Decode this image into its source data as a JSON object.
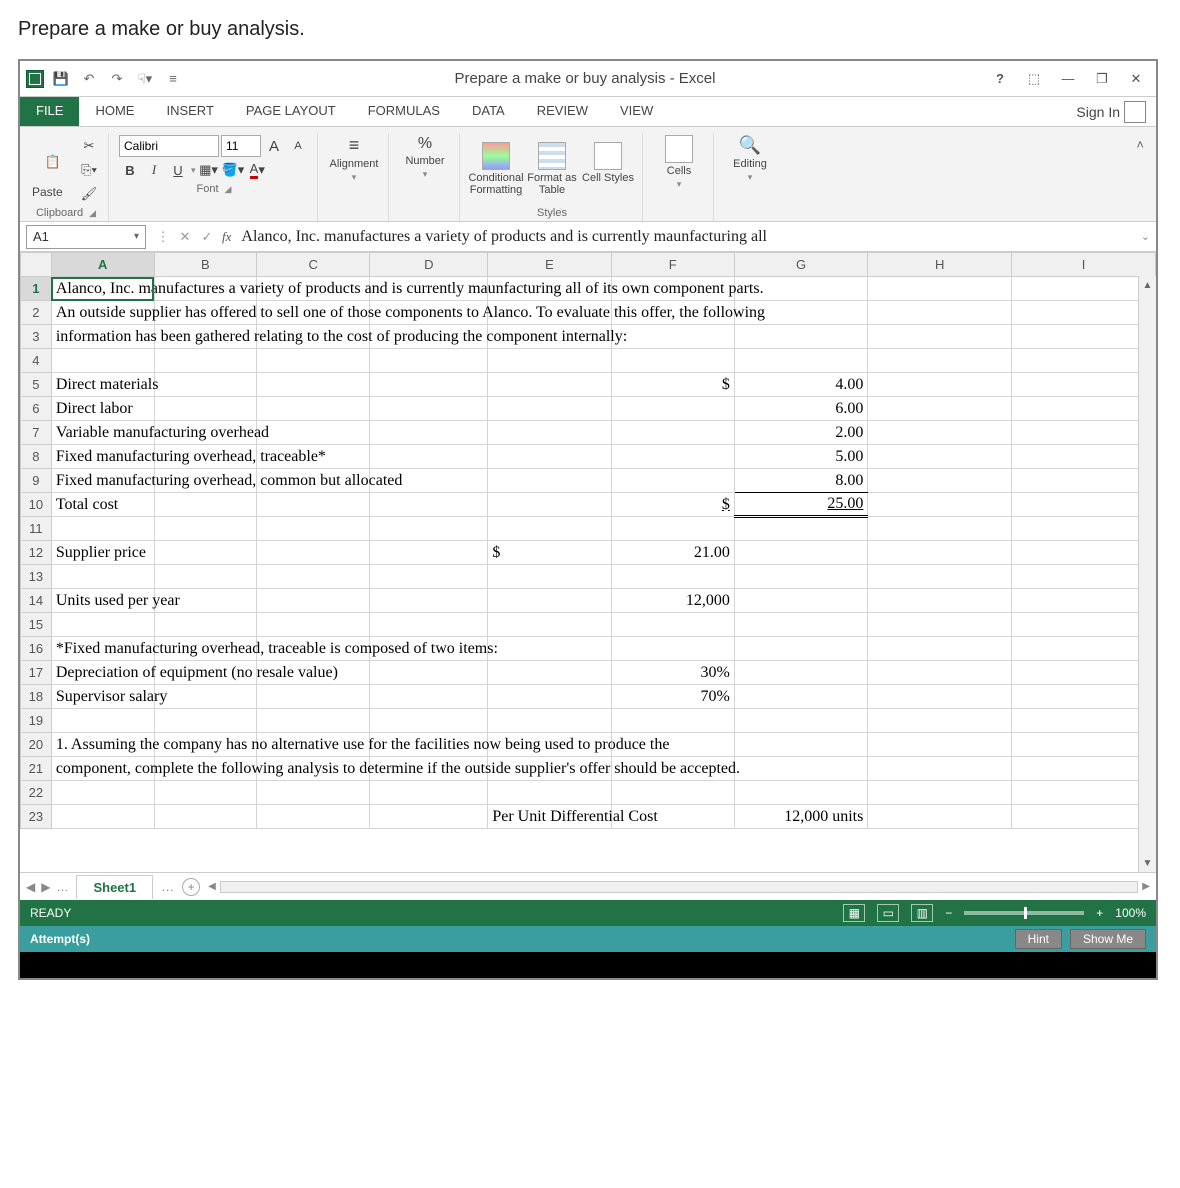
{
  "page_heading": "Prepare a make or buy analysis.",
  "title": "Prepare a make or buy analysis - Excel",
  "menu": {
    "file": "FILE",
    "home": "HOME",
    "insert": "INSERT",
    "page_layout": "PAGE LAYOUT",
    "formulas": "FORMULAS",
    "data": "DATA",
    "review": "REVIEW",
    "view": "VIEW",
    "signin": "Sign In"
  },
  "ribbon": {
    "clipboard": {
      "paste": "Paste",
      "label": "Clipboard"
    },
    "font": {
      "name": "Calibri",
      "size": "11",
      "bold": "B",
      "italic": "I",
      "underline": "U",
      "growA": "A",
      "shrinkA": "A",
      "label": "Font"
    },
    "alignment": {
      "label": "Alignment"
    },
    "number": {
      "percent": "%",
      "label": "Number"
    },
    "styles": {
      "cond": "Conditional Formatting",
      "fmttbl": "Format as Table",
      "cellstyles": "Cell Styles",
      "label": "Styles"
    },
    "cells": {
      "label": "Cells"
    },
    "editing": {
      "label": "Editing"
    }
  },
  "namebox": "A1",
  "formula": "Alanco, Inc. manufactures a variety of products and is currently maunfacturing all",
  "cols": [
    "A",
    "B",
    "C",
    "D",
    "E",
    "F",
    "G",
    "H",
    "I"
  ],
  "rows": {
    "1": {
      "A": "Alanco, Inc. manufactures a variety of products and is currently maunfacturing all of its own component parts."
    },
    "2": {
      "A": "An outside supplier has offered to sell one of those components to Alanco.  To evaluate this offer, the following"
    },
    "3": {
      "A": "information has been gathered relating to the cost of producing the component internally:"
    },
    "5": {
      "A": "Direct materials",
      "F": "$",
      "G": "4.00"
    },
    "6": {
      "A": "Direct labor",
      "G": "6.00"
    },
    "7": {
      "A": "Variable manufacturing overhead",
      "G": "2.00"
    },
    "8": {
      "A": "Fixed manufacturing overhead, traceable*",
      "G": "5.00"
    },
    "9": {
      "A": "Fixed manufacturing overhead, common but allocated",
      "G": "8.00"
    },
    "10": {
      "A": "Total cost",
      "F": "$",
      "G": "25.00"
    },
    "12": {
      "A": "Supplier price",
      "E": "$",
      "F": "21.00"
    },
    "14": {
      "A": "Units used per year",
      "F": "12,000"
    },
    "16": {
      "A": "*Fixed manufacturing overhead, traceable is composed of two items:"
    },
    "17": {
      "A": "      Depreciation of equipment (no resale value)",
      "F": "30%"
    },
    "18": {
      "A": "      Supervisor salary",
      "F": "70%"
    },
    "20": {
      "A": "1. Assuming the company has no alternative use for the facilities now being used to produce the"
    },
    "21": {
      "A": "component, complete the following analysis to determine if the outside supplier's offer should be accepted."
    },
    "23": {
      "E": "Per Unit Differential Cost",
      "G": "12,000 units"
    }
  },
  "sheet": "Sheet1",
  "status": {
    "ready": "READY",
    "zoom": "100%"
  },
  "attempt": {
    "label": "Attempt(s)",
    "hint": "Hint",
    "showme": "Show Me"
  }
}
